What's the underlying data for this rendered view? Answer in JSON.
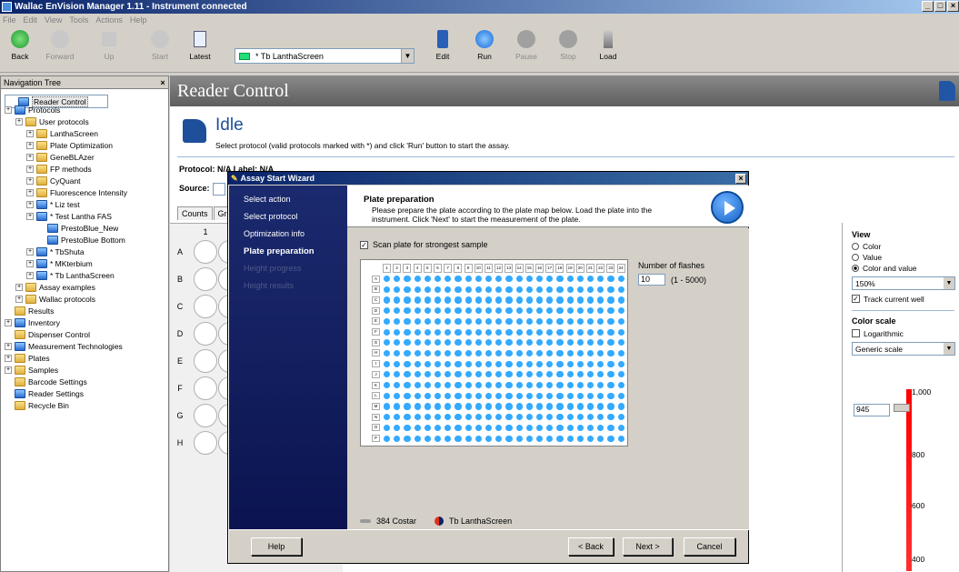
{
  "window": {
    "title": "Wallac EnVision Manager 1.11 - Instrument connected",
    "controls": [
      "_",
      "□",
      "×"
    ]
  },
  "menu": [
    "File",
    "Edit",
    "View",
    "Tools",
    "Actions",
    "Help"
  ],
  "toolbar": {
    "back": "Back",
    "forward": "Forward",
    "up": "Up",
    "start": "Start",
    "latest": "Latest",
    "protocol": "* Tb LanthaScreen",
    "edit": "Edit",
    "run": "Run",
    "pause": "Pause",
    "stop": "Stop",
    "load": "Load"
  },
  "nav": {
    "title": "Navigation Tree",
    "items": [
      "Reader Control",
      "Protocols",
      "User protocols",
      "LanthaScreen",
      "Plate Optimization",
      "GeneBLAzer",
      "FP methods",
      "CyQuant",
      "Fluorescence Intensity",
      "* Liz test",
      "* Test Lantha FAS",
      "PrestoBlue_New",
      "PrestoBlue Bottom",
      "* TbShuta",
      "* MKterbium",
      "* Tb LanthaScreen",
      "Assay examples",
      "Wallac protocols",
      "Results",
      "Inventory",
      "Dispenser Control",
      "Measurement Technologies",
      "Plates",
      "Samples",
      "Barcode Settings",
      "Reader Settings",
      "Recycle Bin"
    ]
  },
  "main": {
    "title": "Reader Control",
    "status": "Idle",
    "instruction": "Select protocol (valid protocols marked with *) and click 'Run' button to start the assay.",
    "protocol_label": "Protocol: N/A    Label: N/A",
    "source_label": "Source:",
    "tabs": [
      "Counts",
      "Gr"
    ],
    "col1": "1",
    "rows": [
      "A",
      "B",
      "C",
      "D",
      "E",
      "F",
      "G",
      "H"
    ]
  },
  "right_panel": {
    "view_title": "View",
    "view_options": [
      "Color",
      "Value",
      "Color and value"
    ],
    "view_selected": 2,
    "zoom": "150%",
    "track": "Track current well",
    "color_scale_title": "Color scale",
    "logarithmic": "Logarithmic",
    "scale_type": "Generic scale",
    "scale_value": "945",
    "ticks": [
      "1,000",
      "800",
      "600",
      "400"
    ]
  },
  "dialog": {
    "title": "Assay Start Wizard",
    "steps": [
      "Select action",
      "Select protocol",
      "Optimization info",
      "Plate preparation",
      "Height progress",
      "Height results"
    ],
    "active_step": 3,
    "header_title": "Plate preparation",
    "header_desc": "Please prepare the plate according to the plate map below. Load the plate into the instrument. Click 'Next' to start the measurement of the plate.",
    "scan_label": "Scan plate for strongest sample",
    "flashes_label": "Number of flashes",
    "flashes_value": "10",
    "flashes_range": "(1 - 5000)",
    "plate_name": "384 Costar",
    "protocol_name": "Tb LanthaScreen",
    "plate_cols": [
      "1",
      "2",
      "3",
      "4",
      "5",
      "6",
      "7",
      "8",
      "9",
      "10",
      "11",
      "12",
      "13",
      "14",
      "15",
      "16",
      "17",
      "18",
      "19",
      "20",
      "21",
      "22",
      "23",
      "24"
    ],
    "plate_rows": [
      "A",
      "B",
      "C",
      "D",
      "E",
      "F",
      "G",
      "H",
      "I",
      "J",
      "K",
      "L",
      "M",
      "N",
      "O",
      "P"
    ],
    "well_color": "#33aaff",
    "help": "Help",
    "back": "< Back",
    "next": "Next >",
    "cancel": "Cancel"
  }
}
